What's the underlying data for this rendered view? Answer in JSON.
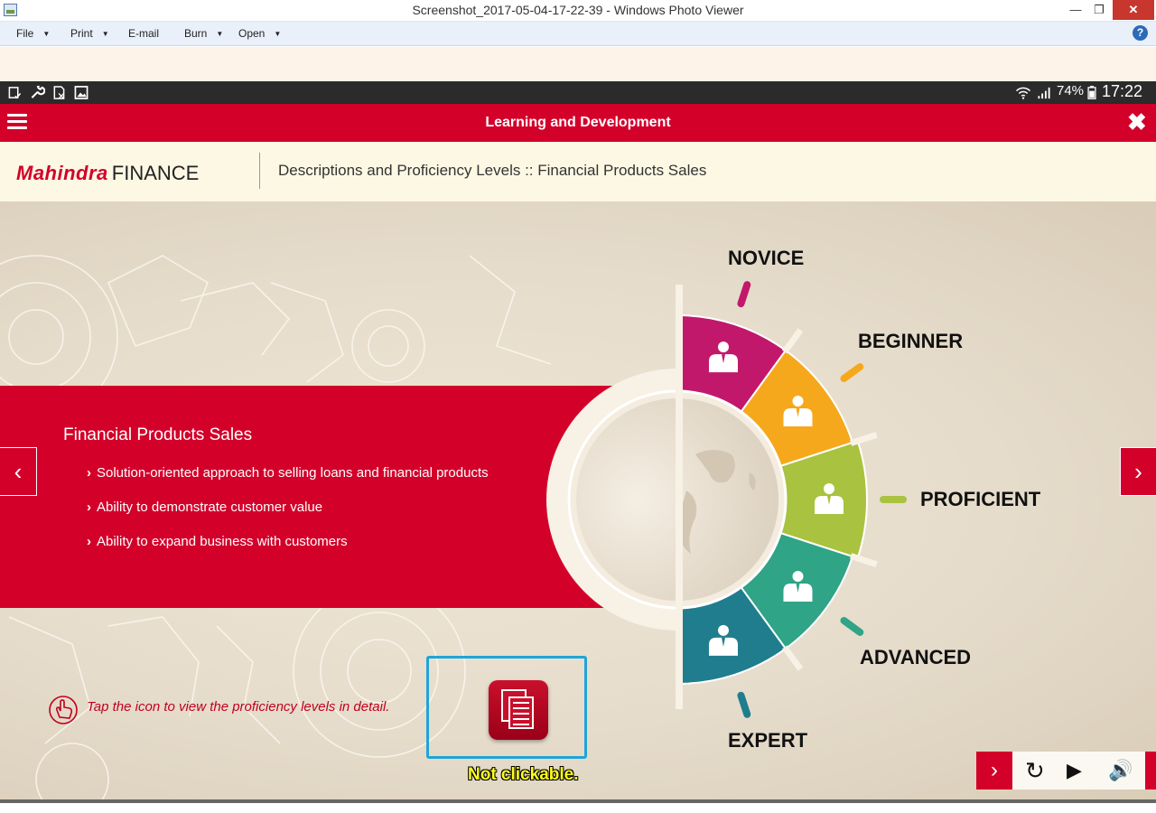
{
  "window": {
    "title": "Screenshot_2017-05-04-17-22-39 - Windows Photo Viewer",
    "minimize": "—",
    "maximize": "❐",
    "close": "✕"
  },
  "menu": {
    "file": "File",
    "print": "Print",
    "email": "E-mail",
    "burn": "Burn",
    "open": "Open",
    "dropdown": "▼",
    "help": "?"
  },
  "status_bar": {
    "battery": "74%",
    "time": "17:22",
    "icons": [
      "sim-icon",
      "wrench-icon",
      "sd-card-icon",
      "image-icon",
      "wifi-icon",
      "signal-icon",
      "battery-icon"
    ]
  },
  "app": {
    "title": "Learning and Development",
    "menu_icon": "hamburger-icon",
    "close_icon": "✖"
  },
  "header": {
    "logo_brand": "Mahindra",
    "logo_word": "FINANCE",
    "breadcrumb": "Descriptions and Proficiency Levels :: Financial Products Sales"
  },
  "panel": {
    "heading": "Financial Products Sales",
    "bullet_marker": "›",
    "bullets": [
      "Solution-oriented approach to selling loans and financial products",
      "Ability to demonstrate customer value",
      "Ability to expand business with customers"
    ]
  },
  "nav": {
    "prev": "‹",
    "next": "›"
  },
  "hint": {
    "text": "Tap the icon to view the proficiency levels in detail.",
    "icon": "tap-hand-icon"
  },
  "doc_button": {
    "icon": "documents-icon",
    "annotation": "Not clickable."
  },
  "levels": [
    {
      "label": "NOVICE",
      "color": "#c2186b"
    },
    {
      "label": "BEGINNER",
      "color": "#f6a81c"
    },
    {
      "label": "PROFICIENT",
      "color": "#a9c23f"
    },
    {
      "label": "ADVANCED",
      "color": "#2fa486"
    },
    {
      "label": "EXPERT",
      "color": "#1f7d8e"
    }
  ],
  "controls": {
    "next": "›",
    "replay": "↻",
    "play": "▶",
    "volume": "🔊"
  },
  "colors": {
    "brand_red": "#d3002a",
    "highlight_blue": "#1fa4d8",
    "annotation_yellow": "#ffff1a"
  }
}
